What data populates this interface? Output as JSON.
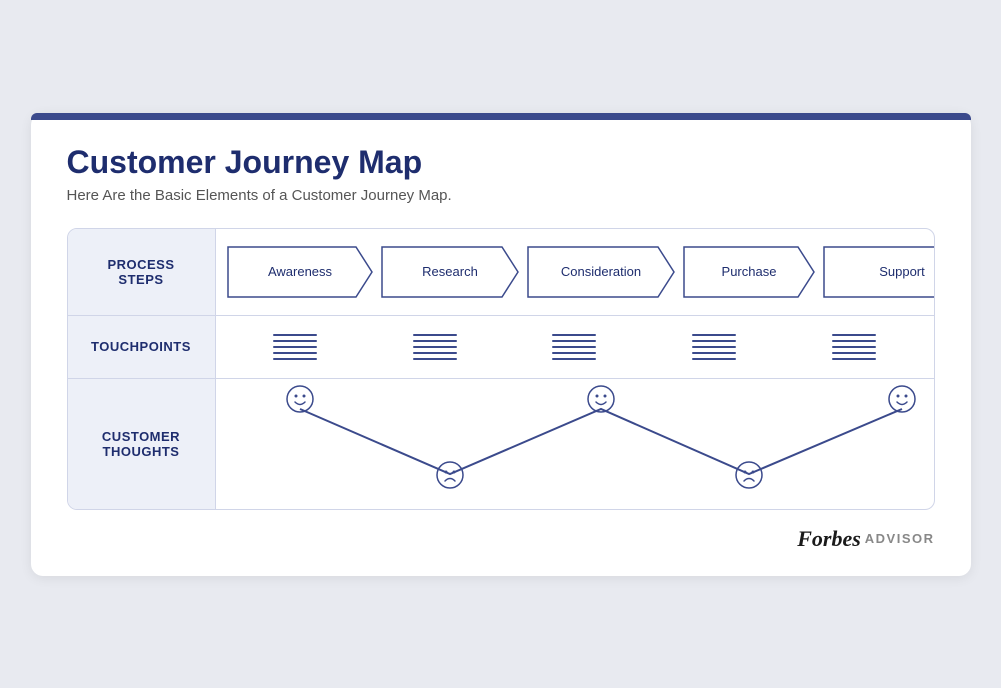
{
  "card": {
    "title": "Customer Journey Map",
    "subtitle": "Here Are the Basic Elements of a Customer Journey Map."
  },
  "table": {
    "rows": [
      {
        "label": "PROCESS\nSTEPS",
        "type": "steps"
      },
      {
        "label": "TOUCHPOINTS",
        "type": "touchpoints"
      },
      {
        "label": "CUSTOMER\nTHOUGHTS",
        "type": "thoughts"
      }
    ],
    "steps": [
      "Awareness",
      "Research",
      "Consideration",
      "Purchase",
      "Support"
    ],
    "touchpoints_count": 5
  },
  "footer": {
    "forbes": "Forbes",
    "advisor": "ADVISOR"
  },
  "colors": {
    "accent": "#3b4a8c",
    "dark": "#1e2d6e",
    "border": "#d0d5e8",
    "bg_label": "#edf0f8"
  }
}
